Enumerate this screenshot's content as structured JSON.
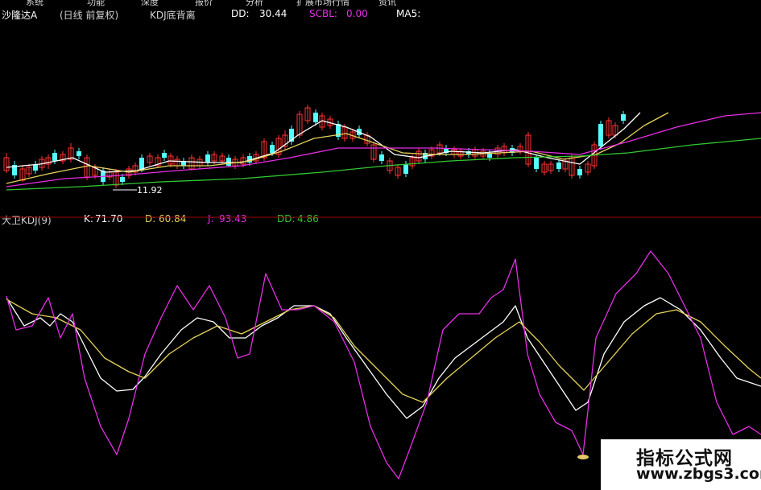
{
  "menu": [
    "系统",
    "功能",
    "深度",
    "报价",
    "分析",
    "扩展市场行情",
    "资讯"
  ],
  "header": {
    "stock_name": "沙隆达A",
    "chart_mode": "(日线 前复权)",
    "indicator_name": "KDJ底背离",
    "dd_label": "DD:",
    "dd_value": "30.44",
    "scbl_label": "SCBL:",
    "scbl_value": "0.00",
    "ma_label": "MA5:"
  },
  "price_annotation": "11.92",
  "kdj": {
    "title": "大卫KDJ(9)",
    "k_label": "K:",
    "k_value": "71.70",
    "d_label": "D:",
    "d_value": "60.84",
    "j_label": "J:",
    "j_value": "93.43",
    "dd_label": "DD:",
    "dd_value": "4.86"
  },
  "colors": {
    "up_candle": "#ff3232",
    "down_candle": "#54ffff",
    "k_line": "#ffffff",
    "d_line": "#e6d25a",
    "j_line": "#e62ee6",
    "ma_white": "#ffffff",
    "ma_yellow": "#e6d25a",
    "ma_magenta": "#e62ee6",
    "ma_green": "#32c832",
    "separator": "#9b0000"
  },
  "watermark": {
    "text": "指标公式网",
    "url": "www.zbgs3.com"
  }
}
